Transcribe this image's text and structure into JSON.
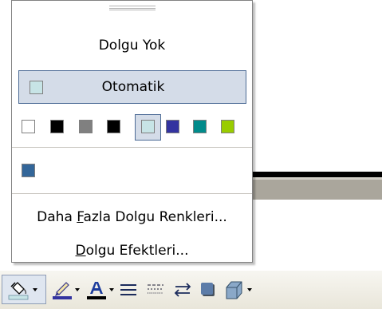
{
  "menu": {
    "no_fill": "Dolgu Yok",
    "automatic": "Otomatik",
    "automatic_color": "#c7e4e6",
    "recent_colors": [
      {
        "name": "white",
        "color": "#ffffff"
      },
      {
        "name": "black",
        "color": "#000000"
      },
      {
        "name": "gray",
        "color": "#808080"
      },
      {
        "name": "black",
        "color": "#000000"
      },
      {
        "name": "light-teal",
        "color": "#c7e4e6",
        "selected": true
      },
      {
        "name": "blue",
        "color": "#3333a0"
      },
      {
        "name": "teal",
        "color": "#008b8b"
      },
      {
        "name": "lime",
        "color": "#99cc00"
      }
    ],
    "custom_color": "#336699",
    "more_colors": {
      "before": "Daha ",
      "accel": "F",
      "after": "azla Dolgu Renkleri..."
    },
    "fill_effects": {
      "accel": "D",
      "after": "olgu Efektleri..."
    }
  },
  "toolbar": {
    "items": [
      "fill-color-icon",
      "line-color-icon",
      "font-color-icon",
      "line-style-icon",
      "dash-style-icon",
      "arrow-style-icon",
      "shadow-style-icon",
      "3d-style-icon"
    ],
    "fill_color_bar": "#c7e4e6",
    "line_color_bar": "#3333a0",
    "font_color_bar": "#000000"
  }
}
